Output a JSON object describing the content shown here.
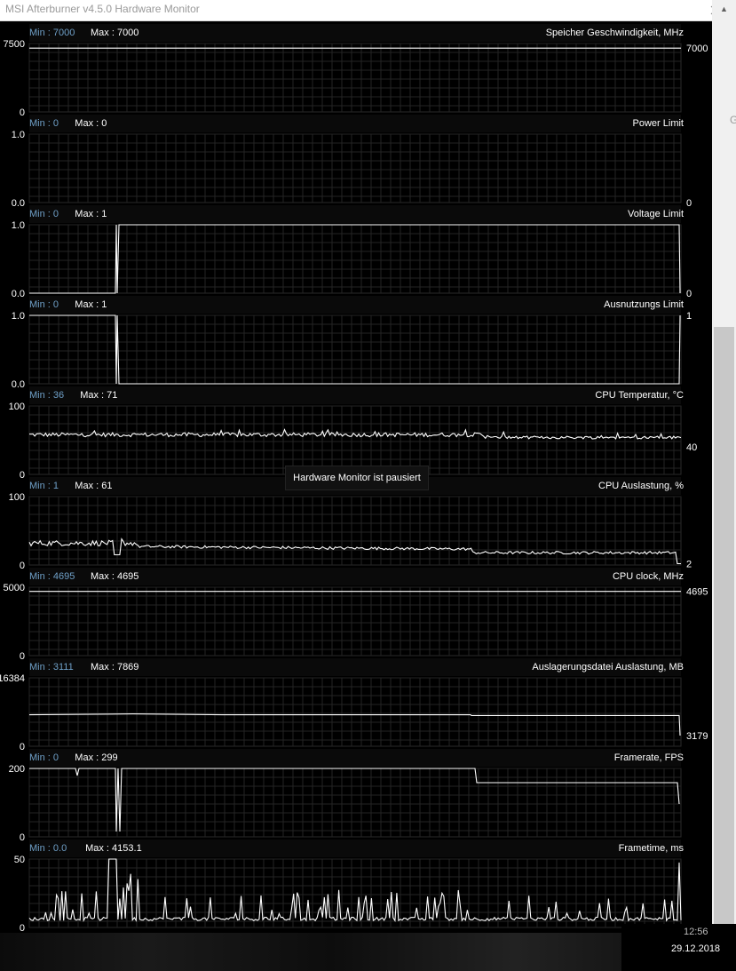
{
  "window": {
    "title": "MSI Afterburner v4.5.0 Hardware Monitor"
  },
  "tooltip": "Hardware Monitor ist pausiert",
  "taskbar": {
    "time": "12:56",
    "date": "29.12.2018"
  },
  "edge_glyph": "G",
  "graphs": [
    {
      "name": "Speicher Geschwindigkeit, MHz",
      "min_label": "Min :",
      "min": "7000",
      "max_label": "Max :",
      "max": "7000",
      "axis_top": "7500",
      "axis_bottom": "0",
      "current": "7000",
      "shape": "flat",
      "level": 0.933
    },
    {
      "name": "Power Limit",
      "min_label": "Min :",
      "min": "0",
      "max_label": "Max :",
      "max": "0",
      "axis_top": "1.0",
      "axis_bottom": "0.0",
      "current": "0",
      "shape": "none",
      "level": 0
    },
    {
      "name": "Voltage Limit",
      "min_label": "Min :",
      "min": "0",
      "max_label": "Max :",
      "max": "1",
      "axis_top": "1.0",
      "axis_bottom": "0.0",
      "current": "0",
      "shape": "step_up",
      "level": 1
    },
    {
      "name": "Ausnutzungs Limit",
      "min_label": "Min :",
      "min": "0",
      "max_label": "Max :",
      "max": "1",
      "axis_top": "1.0",
      "axis_bottom": "0.0",
      "current": "1",
      "shape": "step_down",
      "level": 0
    },
    {
      "name": "CPU Temperatur, °C",
      "min_label": "Min :",
      "min": "36",
      "max_label": "Max :",
      "max": "71",
      "axis_top": "100",
      "axis_bottom": "0",
      "current": "40",
      "shape": "noisy",
      "level": 0.58
    },
    {
      "name": "CPU Auslastung, %",
      "min_label": "Min :",
      "min": "1",
      "max_label": "Max :",
      "max": "61",
      "axis_top": "100",
      "axis_bottom": "0",
      "current": "2",
      "shape": "noisy_decline",
      "level": 0.3
    },
    {
      "name": "CPU clock, MHz",
      "min_label": "Min :",
      "min": "4695",
      "max_label": "Max :",
      "max": "4695",
      "axis_top": "5000",
      "axis_bottom": "0",
      "current": "4695",
      "shape": "flat",
      "level": 0.939
    },
    {
      "name": "Auslagerungsdatei Auslastung, MB",
      "min_label": "Min :",
      "min": "3111",
      "max_label": "Max :",
      "max": "7869",
      "axis_top": "16384",
      "axis_bottom": "0",
      "current": "3179",
      "shape": "flat_drop",
      "level": 0.46
    },
    {
      "name": "Framerate, FPS",
      "min_label": "Min :",
      "min": "0",
      "max_label": "Max :",
      "max": "299",
      "axis_top": "200",
      "axis_bottom": "0",
      "current": "",
      "shape": "fps",
      "level": 1
    },
    {
      "name": "Frametime, ms",
      "min_label": "Min :",
      "min": "0.0",
      "max_label": "Max :",
      "max": "4153.1",
      "axis_top": "50",
      "axis_bottom": "0",
      "current": "",
      "shape": "spiky",
      "level": 0.15
    }
  ]
}
